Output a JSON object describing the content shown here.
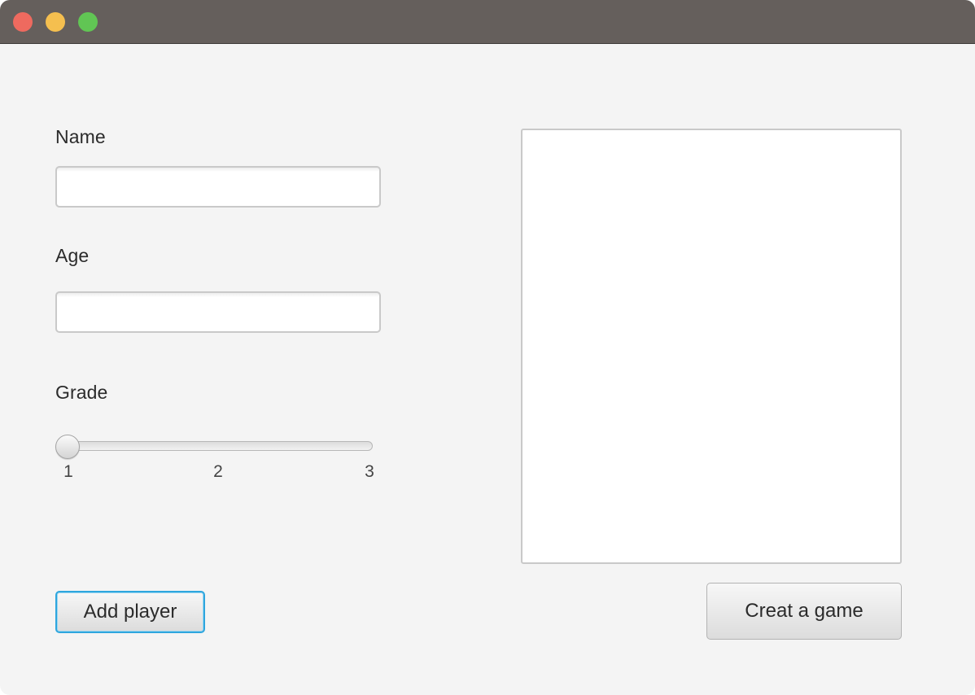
{
  "window": {
    "controls": {
      "close_color": "#ee6a5f",
      "minimize_color": "#f5bf4f",
      "zoom_color": "#61c554"
    }
  },
  "form": {
    "name": {
      "label": "Name",
      "value": "",
      "placeholder": ""
    },
    "age": {
      "label": "Age",
      "value": "",
      "placeholder": ""
    },
    "grade": {
      "label": "Grade",
      "min": 1,
      "max": 3,
      "value": 1,
      "ticks": [
        "1",
        "2",
        "3"
      ]
    }
  },
  "players_list": {
    "items": []
  },
  "buttons": {
    "add_player": "Add player",
    "create_game": "Creat a game"
  },
  "colors": {
    "titlebar": "#655f5c",
    "background": "#f4f4f4",
    "focus_border": "#2ea6de"
  }
}
